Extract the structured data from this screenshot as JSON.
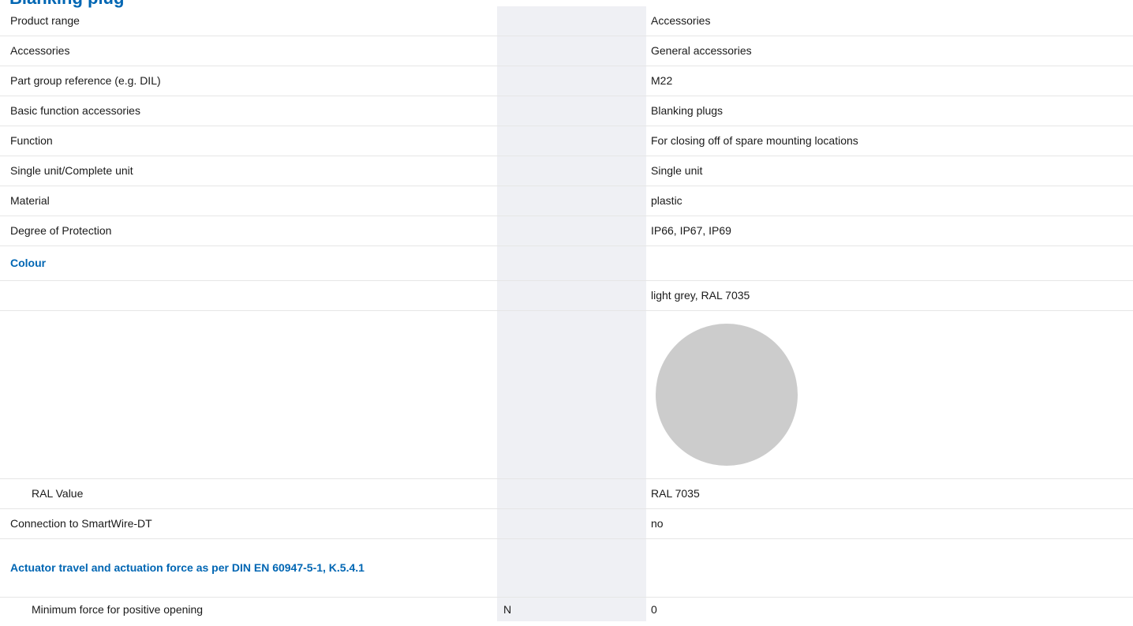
{
  "page": {
    "title_fragment": "Blanking plug"
  },
  "rows": [
    {
      "label": "Product range",
      "unit": "",
      "value": "Accessories"
    },
    {
      "label": "Accessories",
      "unit": "",
      "value": "General accessories"
    },
    {
      "label": "Part group reference (e.g. DIL)",
      "unit": "",
      "value": "M22"
    },
    {
      "label": "Basic function accessories",
      "unit": "",
      "value": "Blanking plugs"
    },
    {
      "label": "Function",
      "unit": "",
      "value": "For closing off of spare mounting locations"
    },
    {
      "label": "Single unit/Complete unit",
      "unit": "",
      "value": "Single unit"
    },
    {
      "label": "Material",
      "unit": "",
      "value": "plastic"
    },
    {
      "label": "Degree of Protection",
      "unit": "",
      "value": "IP66, IP67, IP69"
    }
  ],
  "colour_section": {
    "heading": "Colour",
    "value": "light grey, RAL 7035",
    "swatch_color": "#cccccc",
    "ral_label": "RAL Value",
    "ral_value": "RAL 7035"
  },
  "smartwire": {
    "label": "Connection to SmartWire-DT",
    "value": "no"
  },
  "actuator_section": {
    "heading": "Actuator travel and actuation force as per DIN EN 60947-5-1, K.5.4.1",
    "min_force_label": "Minimum force for positive opening",
    "min_force_unit": "N",
    "min_force_value": "0"
  },
  "colors": {
    "accent": "#0066b3",
    "unit_column_bg": "#eff0f4",
    "row_border": "#e6e6e6"
  }
}
